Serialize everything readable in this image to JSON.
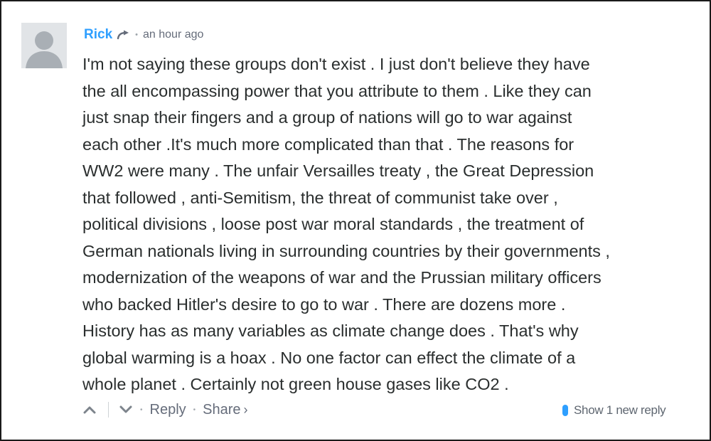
{
  "comment": {
    "author": "Rick",
    "timestamp": "an hour ago",
    "body_lines": [
      "I'm not saying these groups don't exist . I just don't believe they have",
      "the all encompassing power that you attribute to them . Like they can",
      "just snap their fingers and a group of nations will go to war against",
      "each other .It's much more complicated than that . The reasons for",
      "WW2 were many . The unfair Versailles treaty , the Great Depression",
      "that followed , anti-Semitism, the threat of communist take over ,",
      "political divisions , loose post war moral standards , the treatment of",
      "German nationals living in surrounding countries by their governments ,",
      "modernization of the weapons of war and the Prussian military officers",
      "who backed Hitler's desire to go to war . There are dozens more .",
      "History has as many variables as climate change does . That's why",
      "global warming is a hoax . No one factor can effect the climate of a",
      "whole planet . Certainly not green house gases like CO2 ."
    ]
  },
  "actions": {
    "reply_label": "Reply",
    "share_label": "Share",
    "share_chevron": "›",
    "dot": "•",
    "show_new_reply": "Show 1 new reply"
  },
  "icons": {
    "reply_arrow": "arrow-right-icon",
    "upvote": "chevron-up-icon",
    "downvote": "chevron-down-icon",
    "avatar": "default-avatar-icon"
  },
  "colors": {
    "accent": "#2e9fff",
    "text": "#2a2e2e",
    "muted": "#656c7a",
    "border": "#1a1a1a"
  }
}
